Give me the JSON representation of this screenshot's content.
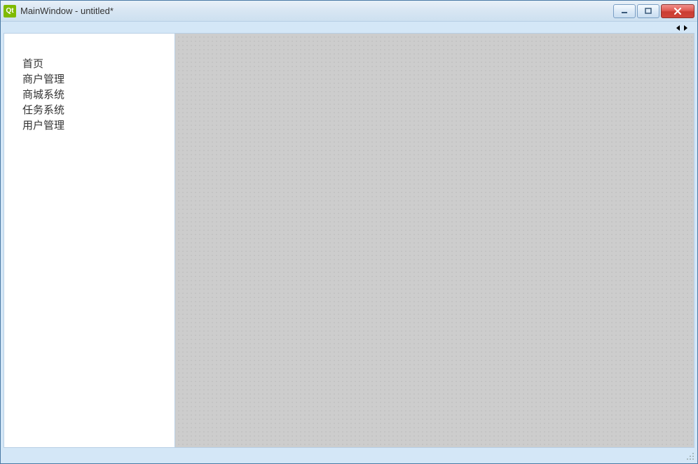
{
  "window": {
    "title": "MainWindow - untitled*",
    "icon_label": "Qt"
  },
  "sidebar": {
    "items": [
      {
        "label": "首页"
      },
      {
        "label": "商户管理"
      },
      {
        "label": "商城系统"
      },
      {
        "label": "任务系统"
      },
      {
        "label": "用户管理"
      }
    ]
  },
  "tab_nav": {
    "left_arrow": "◂",
    "right_arrow": "▸"
  }
}
